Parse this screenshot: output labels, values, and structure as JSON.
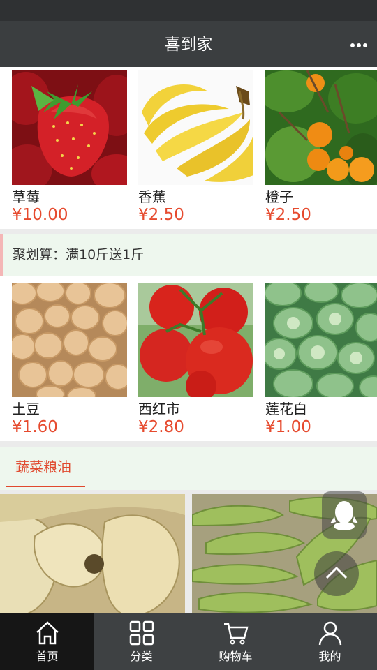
{
  "header": {
    "title": "喜到家"
  },
  "top_products": [
    {
      "name": "草莓",
      "price": "¥10.00"
    },
    {
      "name": "香蕉",
      "price": "¥2.50"
    },
    {
      "name": "橙子",
      "price": "¥2.50"
    }
  ],
  "promo": {
    "text": "聚划算：满10斤送1斤"
  },
  "promo_products": [
    {
      "name": "土豆",
      "price": "¥1.60"
    },
    {
      "name": "西红市",
      "price": "¥2.80"
    },
    {
      "name": "莲花白",
      "price": "¥1.00"
    }
  ],
  "section": {
    "title": "蔬菜粮油"
  },
  "tabs": [
    {
      "label": "首页",
      "icon": "home-icon",
      "active": true
    },
    {
      "label": "分类",
      "icon": "grid-icon",
      "active": false
    },
    {
      "label": "购物车",
      "icon": "cart-icon",
      "active": false
    },
    {
      "label": "我的",
      "icon": "user-icon",
      "active": false
    }
  ],
  "colors": {
    "accent": "#e64a2e",
    "header_bg": "#3b3e40",
    "tabbar_bg": "#3e4143",
    "section_bg": "#eef7ee"
  }
}
